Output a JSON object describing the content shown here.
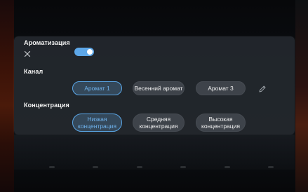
{
  "aroma": {
    "title": "Ароматизация",
    "toggle_on": true,
    "accent_color": "#5da7e8"
  },
  "channel": {
    "title": "Канал",
    "options": [
      {
        "label": "Аромат 1",
        "selected": true
      },
      {
        "label": "Весенний аромат",
        "selected": false
      },
      {
        "label": "Аромат 3",
        "selected": false
      }
    ]
  },
  "concentration": {
    "title": "Концентрация",
    "options": [
      {
        "label": "Низкая концентрация",
        "selected": true
      },
      {
        "label": "Средняя концентрация",
        "selected": false
      },
      {
        "label": "Высокая концентрация",
        "selected": false
      }
    ]
  },
  "icons": {
    "close": "close-icon",
    "edit": "pencil-icon"
  }
}
